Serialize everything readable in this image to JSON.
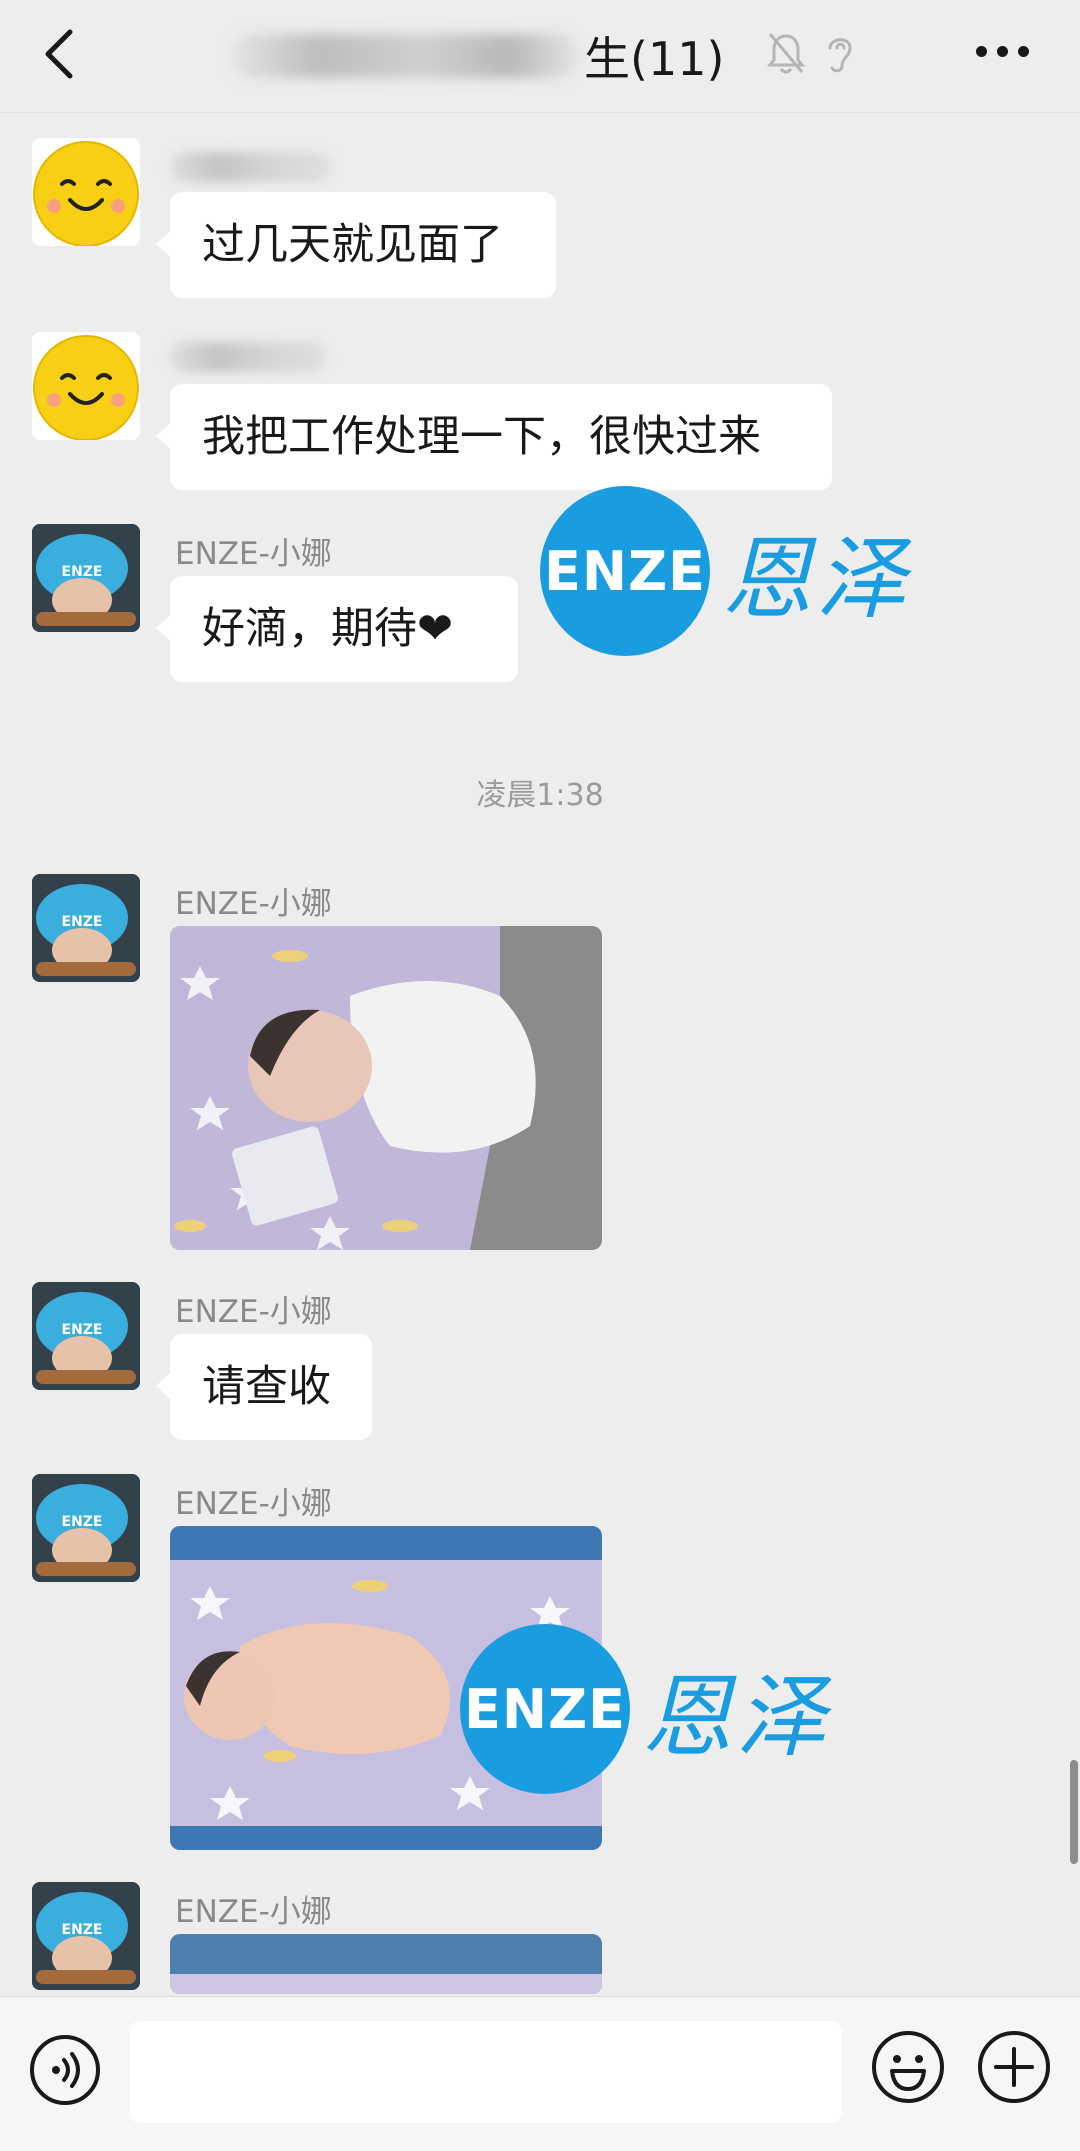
{
  "header": {
    "title_suffix": "生(11)",
    "icons": [
      "back-icon",
      "mute-bell-icon",
      "earpiece-icon",
      "more-icon"
    ]
  },
  "messages": [
    {
      "sender": "",
      "text": "过几天就见面了",
      "avatar": "smiley-face-avatar"
    },
    {
      "sender": "",
      "text": "我把工作处理一下，很快过来",
      "avatar": "smiley-face-avatar"
    },
    {
      "sender": "ENZE-小娜",
      "text": "好滴，期待❤",
      "avatar": "baby-chef-hat-avatar"
    },
    {
      "sender": "ENZE-小娜",
      "type": "image",
      "avatar": "baby-chef-hat-avatar"
    },
    {
      "sender": "ENZE-小娜",
      "text": "请查收",
      "avatar": "baby-chef-hat-avatar"
    },
    {
      "sender": "ENZE-小娜",
      "type": "image",
      "avatar": "baby-chef-hat-avatar"
    },
    {
      "sender": "ENZE-小娜",
      "type": "image",
      "avatar": "baby-chef-hat-avatar"
    }
  ],
  "timestamp": "凌晨1:38",
  "watermark": {
    "latin": "ENZE",
    "chinese": "恩泽"
  },
  "avatar_hat_text": "ENZE",
  "colors": {
    "background": "#ededed",
    "bubble": "#ffffff",
    "brand_blue": "#1a9de0"
  },
  "input": {
    "value": ""
  },
  "bottom_icons": [
    "voice-icon",
    "emoji-icon",
    "plus-icon"
  ]
}
